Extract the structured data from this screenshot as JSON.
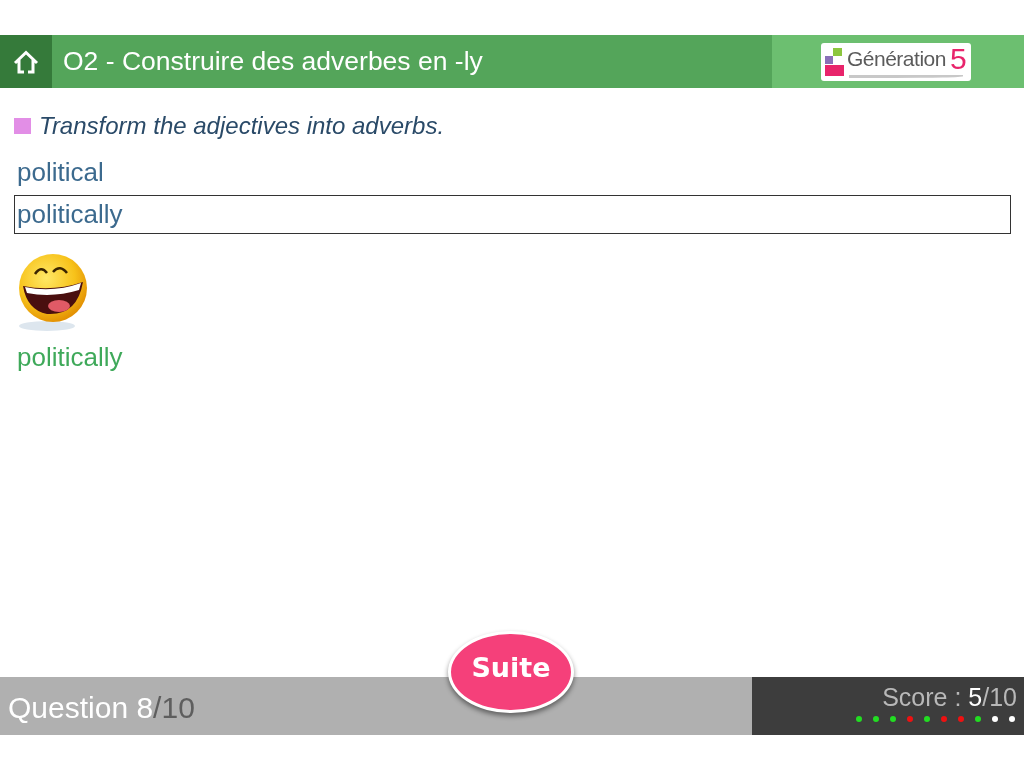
{
  "header": {
    "title": "O2 - Construire des adverbes en -ly",
    "logo": {
      "name": "Génération",
      "number": "5"
    }
  },
  "instruction": "Transform the adjectives into adverbs.",
  "exercise": {
    "prompt": "political",
    "answer": "politically",
    "correct": true,
    "correction": "politically"
  },
  "footer": {
    "question": {
      "label": "Question",
      "current": "8",
      "total": "/10"
    },
    "next_button": "Suite",
    "score": {
      "label": "Score :",
      "value": "5",
      "total": "/10"
    },
    "progress": [
      {
        "color": "#22dd22"
      },
      {
        "color": "#22dd22"
      },
      {
        "color": "#22dd22"
      },
      {
        "color": "#ee1111"
      },
      {
        "color": "#22dd22"
      },
      {
        "color": "#ee1111"
      },
      {
        "color": "#ee1111"
      },
      {
        "color": "#22dd22"
      },
      {
        "color": "#ffffff"
      },
      {
        "color": "#ffffff"
      }
    ]
  }
}
